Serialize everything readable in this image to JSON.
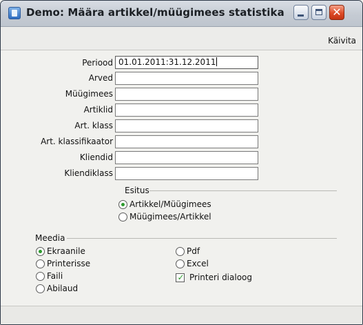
{
  "window": {
    "title": "Demo: Määra artikkel/müügimees statistika",
    "icons": {
      "app": "app-icon",
      "minimize": "minimize-icon",
      "maximize": "maximize-icon",
      "close": "close-icon"
    },
    "close_glyph": "✕"
  },
  "toolbar": {
    "run_label": "Käivita"
  },
  "form": {
    "fields": [
      {
        "label": "Periood",
        "value": "01.01.2011:31.12.2011"
      },
      {
        "label": "Arved",
        "value": ""
      },
      {
        "label": "Müügimees",
        "value": ""
      },
      {
        "label": "Artiklid",
        "value": ""
      },
      {
        "label": "Art. klass",
        "value": ""
      },
      {
        "label": "Art. klassifikaator",
        "value": ""
      },
      {
        "label": "Kliendid",
        "value": ""
      },
      {
        "label": "Kliendiklass",
        "value": ""
      }
    ]
  },
  "esitus": {
    "title": "Esitus",
    "options": [
      {
        "label": "Artikkel/Müügimees",
        "selected": true
      },
      {
        "label": "Müügimees/Artikkel",
        "selected": false
      }
    ]
  },
  "meedia": {
    "title": "Meedia",
    "options": [
      {
        "label": "Ekraanile",
        "selected": true
      },
      {
        "label": "Printerisse",
        "selected": false
      },
      {
        "label": "Faili",
        "selected": false
      },
      {
        "label": "Abilaud",
        "selected": false
      },
      {
        "label": "Pdf",
        "selected": false
      },
      {
        "label": "Excel",
        "selected": false
      }
    ],
    "printer_dialog": {
      "label": "Printeri dialoog",
      "checked": true,
      "check_glyph": "✓"
    }
  },
  "colors": {
    "accent_radio": "#2c9a2c",
    "close_button": "#dd4b27"
  }
}
